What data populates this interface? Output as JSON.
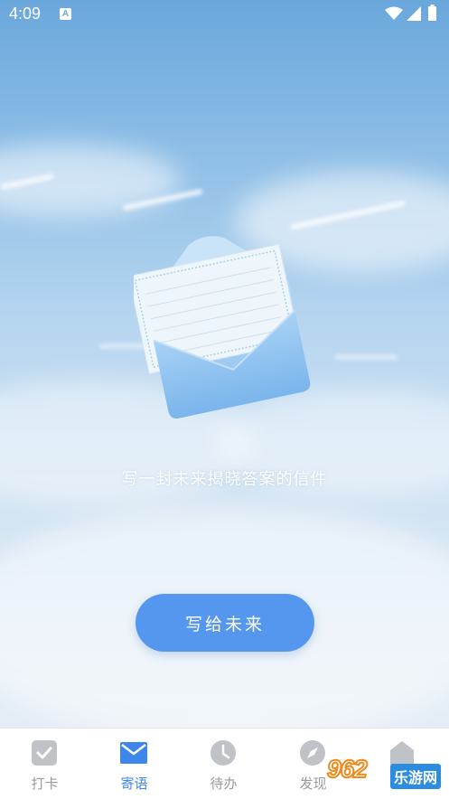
{
  "status_bar": {
    "time": "4:09",
    "notification_letter": "A"
  },
  "main": {
    "message": "写一封未来揭晓答案的信件",
    "write_button_label": "写给未来"
  },
  "tabs": [
    {
      "label": "打卡",
      "icon": "check-icon",
      "active": false
    },
    {
      "label": "寄语",
      "icon": "mail-icon",
      "active": true
    },
    {
      "label": "待办",
      "icon": "clock-icon",
      "active": false
    },
    {
      "label": "发现",
      "icon": "compass-icon",
      "active": false
    }
  ],
  "watermark": {
    "number": "962",
    "text": "乐游网"
  },
  "colors": {
    "accent": "#5597ee",
    "active_tab": "#3d86ea",
    "inactive_tab": "#9a9a9a"
  }
}
